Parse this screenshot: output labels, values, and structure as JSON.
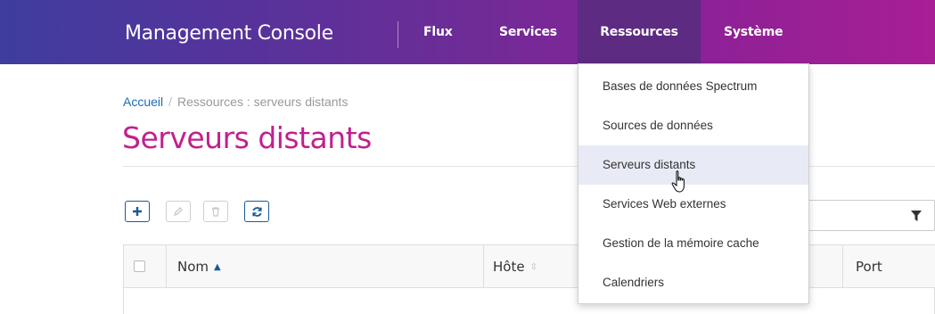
{
  "header": {
    "app_title": "Management Console",
    "nav": [
      {
        "label": "Flux"
      },
      {
        "label": "Services"
      },
      {
        "label": "Ressources",
        "active": true
      },
      {
        "label": "Système"
      }
    ],
    "active_nav_color": "#5d2b82"
  },
  "dropdown": {
    "items": [
      {
        "label": "Bases de données Spectrum"
      },
      {
        "label": "Sources de données"
      },
      {
        "label": "Serveurs distants",
        "active": true
      },
      {
        "label": "Services Web externes"
      },
      {
        "label": "Gestion de la mémoire cache"
      },
      {
        "label": "Calendriers"
      }
    ]
  },
  "breadcrumb": {
    "home": "Accueil",
    "separator": "/",
    "current": "Ressources : serveurs distants"
  },
  "page": {
    "title": "Serveurs distants",
    "title_color": "#c1208e"
  },
  "toolbar": {
    "add_icon": "plus-icon",
    "edit_icon": "pencil-icon",
    "delete_icon": "trash-icon",
    "refresh_icon": "refresh-icon",
    "filter_icon": "filter-icon"
  },
  "table": {
    "columns": [
      {
        "label": "Nom",
        "sort": "ascending"
      },
      {
        "label": "Hôte",
        "sort": "sortable"
      },
      {
        "label": "Port"
      }
    ]
  }
}
